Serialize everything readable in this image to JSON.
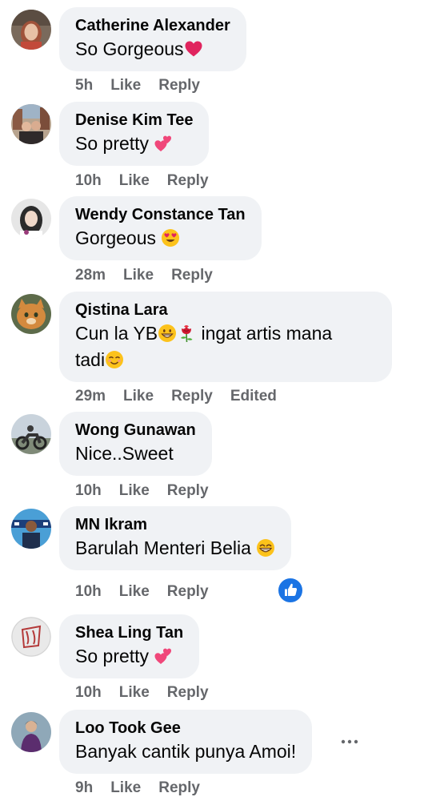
{
  "comments": [
    {
      "name": "Catherine Alexander",
      "text": "So Gorgeous",
      "emoji": "red-heart",
      "time": "5h",
      "like": "Like",
      "reply": "Reply"
    },
    {
      "name": "Denise Kim Tee",
      "text": "So pretty ",
      "emoji": "two-hearts",
      "time": "10h",
      "like": "Like",
      "reply": "Reply"
    },
    {
      "name": "Wendy Constance Tan",
      "text": "Gorgeous ",
      "emoji": "heart-eyes",
      "time": "28m",
      "like": "Like",
      "reply": "Reply"
    },
    {
      "name": "Qistina Lara",
      "text_part1": "Cun la YB",
      "text_part2": " ingat artis mana",
      "text_part3": "tadi",
      "emojis": [
        "grinning-face",
        "rose",
        "smiling-face"
      ],
      "time": "29m",
      "like": "Like",
      "reply": "Reply",
      "edited": "Edited"
    },
    {
      "name": "Wong Gunawan",
      "text": "Nice..Sweet",
      "time": "10h",
      "like": "Like",
      "reply": "Reply"
    },
    {
      "name": "MN Ikram",
      "text": "Barulah Menteri Belia ",
      "emoji": "grinning-face",
      "time": "10h",
      "like": "Like",
      "reply": "Reply",
      "reaction": "like-thumb"
    },
    {
      "name": "Shea Ling Tan",
      "text": "So pretty ",
      "emoji": "two-hearts",
      "time": "10h",
      "like": "Like",
      "reply": "Reply"
    },
    {
      "name": "Loo Took Gee",
      "text": "Banyak cantik punya Amoi!",
      "time": "9h",
      "like": "Like",
      "reply": "Reply",
      "menu": "more-options"
    }
  ],
  "colors": {
    "bubble": "#f0f2f5",
    "meta": "#65676b",
    "like_blue": "#1b74e4"
  }
}
